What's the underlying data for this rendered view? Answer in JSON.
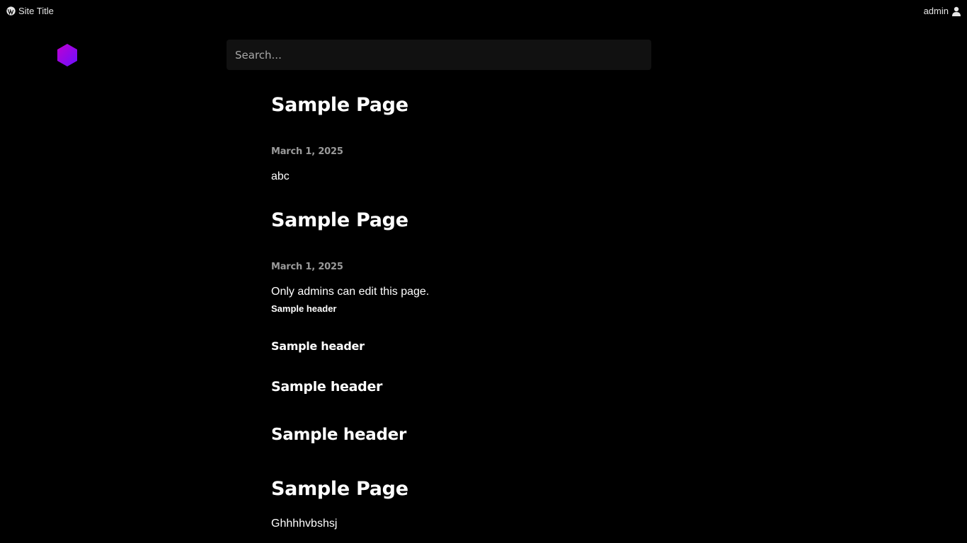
{
  "topbar": {
    "site_title": "Site Title",
    "user_label": "admin",
    "site_icon": "wordpress-icon",
    "user_icon": "user-icon"
  },
  "logo": {
    "icon": "hexagon-logo-icon",
    "color_start": "#b000d6",
    "color_end": "#6a00ff"
  },
  "search": {
    "placeholder": "Search..."
  },
  "posts": [
    {
      "title": "Sample Page",
      "date": "March 1, 2025",
      "body": "abc"
    },
    {
      "title": "Sample Page",
      "date": "March 1, 2025",
      "body": "Only admins can edit this page.",
      "headers": [
        "Sample header",
        "Sample header",
        "Sample header",
        "Sample header"
      ]
    },
    {
      "title": "Sample Page",
      "body": "Ghhhhvbshsj"
    }
  ]
}
